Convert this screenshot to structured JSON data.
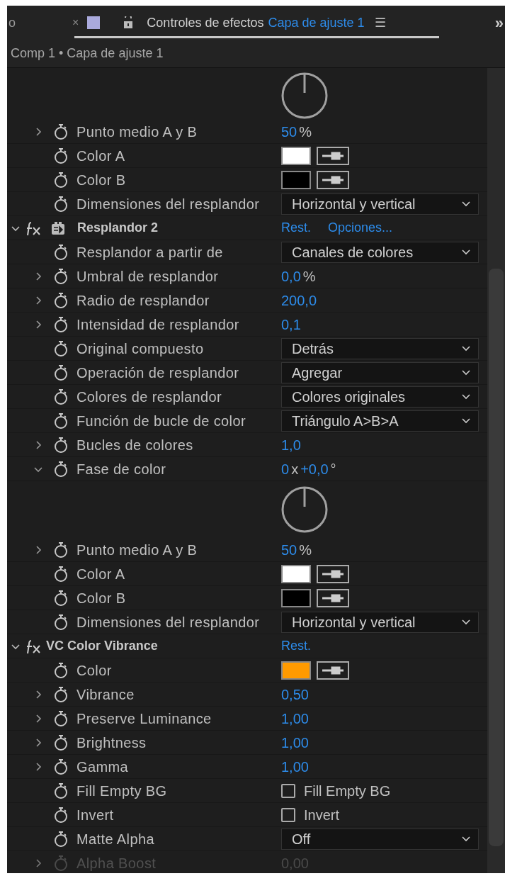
{
  "tab_bar": {
    "prev_tab": "o",
    "close": "×",
    "title": "Controles de efectos",
    "layer": "Capa de ajuste 1",
    "menu": "☰",
    "overflow": "»"
  },
  "breadcrumb": "Comp 1 • Capa de ajuste 1",
  "rows": [
    {
      "kind": "dial"
    },
    {
      "kind": "param",
      "label": "Punto medio A y B",
      "expandable": true,
      "expanded": false,
      "value": {
        "kind": "number",
        "segments": [
          {
            "kind": "number",
            "text": "50"
          },
          {
            "kind": "unit",
            "text": "%"
          }
        ]
      }
    },
    {
      "kind": "param",
      "label": "Color A",
      "expandable": false,
      "value": {
        "kind": "color",
        "color": "#ffffff"
      }
    },
    {
      "kind": "param",
      "label": "Color B",
      "expandable": false,
      "value": {
        "kind": "color",
        "color": "#000000"
      }
    },
    {
      "kind": "param",
      "label": "Dimensiones del resplandor",
      "expandable": false,
      "value": {
        "kind": "dropdown",
        "text": "Horizontal y vertical"
      }
    },
    {
      "kind": "effect",
      "name": "Resplandor 2",
      "expanded": true,
      "plugin_icon": true,
      "links": [
        "Rest.",
        "Opciones..."
      ]
    },
    {
      "kind": "param",
      "label": "Resplandor a partir de",
      "expandable": false,
      "value": {
        "kind": "dropdown",
        "text": "Canales de colores"
      }
    },
    {
      "kind": "param",
      "label": "Umbral de resplandor",
      "expandable": true,
      "expanded": false,
      "value": {
        "kind": "number",
        "segments": [
          {
            "kind": "number",
            "text": "0,0"
          },
          {
            "kind": "unit",
            "text": "%"
          }
        ]
      }
    },
    {
      "kind": "param",
      "label": "Radio de resplandor",
      "expandable": true,
      "expanded": false,
      "value": {
        "kind": "number",
        "segments": [
          {
            "kind": "number",
            "text": "200,0"
          }
        ]
      }
    },
    {
      "kind": "param",
      "label": "Intensidad de resplandor",
      "expandable": true,
      "expanded": false,
      "value": {
        "kind": "number",
        "segments": [
          {
            "kind": "number",
            "text": "0,1"
          }
        ]
      }
    },
    {
      "kind": "param",
      "label": "Original compuesto",
      "expandable": false,
      "value": {
        "kind": "dropdown",
        "text": "Detrás"
      }
    },
    {
      "kind": "param",
      "label": "Operación de resplandor",
      "expandable": false,
      "value": {
        "kind": "dropdown",
        "text": "Agregar"
      }
    },
    {
      "kind": "param",
      "label": "Colores de resplandor",
      "expandable": false,
      "value": {
        "kind": "dropdown",
        "text": "Colores originales"
      }
    },
    {
      "kind": "param",
      "label": "Función de bucle de color",
      "expandable": false,
      "value": {
        "kind": "dropdown",
        "text": "Triángulo A>B>A"
      }
    },
    {
      "kind": "param",
      "label": "Bucles de colores",
      "expandable": true,
      "expanded": false,
      "value": {
        "kind": "number",
        "segments": [
          {
            "kind": "number",
            "text": "1,0"
          }
        ]
      }
    },
    {
      "kind": "param",
      "label": "Fase de color",
      "expandable": true,
      "expanded": true,
      "value": {
        "kind": "number",
        "segments": [
          {
            "kind": "number",
            "text": "0"
          },
          {
            "kind": "unit",
            "text": "x"
          },
          {
            "kind": "number",
            "text": "+0,0"
          },
          {
            "kind": "unit",
            "text": "°"
          }
        ]
      }
    },
    {
      "kind": "dial"
    },
    {
      "kind": "param",
      "label": "Punto medio A y B",
      "expandable": true,
      "expanded": false,
      "value": {
        "kind": "number",
        "segments": [
          {
            "kind": "number",
            "text": "50"
          },
          {
            "kind": "unit",
            "text": "%"
          }
        ]
      }
    },
    {
      "kind": "param",
      "label": "Color A",
      "expandable": false,
      "value": {
        "kind": "color",
        "color": "#ffffff"
      }
    },
    {
      "kind": "param",
      "label": "Color B",
      "expandable": false,
      "value": {
        "kind": "color",
        "color": "#000000"
      }
    },
    {
      "kind": "param",
      "label": "Dimensiones del resplandor",
      "expandable": false,
      "value": {
        "kind": "dropdown",
        "text": "Horizontal y vertical"
      }
    },
    {
      "kind": "effect",
      "name": "VC Color Vibrance",
      "expanded": true,
      "plugin_icon": false,
      "links": [
        "Rest."
      ]
    },
    {
      "kind": "param",
      "label": "Color",
      "expandable": false,
      "value": {
        "kind": "color",
        "color": "#ff9a00"
      }
    },
    {
      "kind": "param",
      "label": "Vibrance",
      "expandable": true,
      "expanded": false,
      "value": {
        "kind": "number",
        "segments": [
          {
            "kind": "number",
            "text": "0,50"
          }
        ]
      }
    },
    {
      "kind": "param",
      "label": "Preserve Luminance",
      "expandable": true,
      "expanded": false,
      "value": {
        "kind": "number",
        "segments": [
          {
            "kind": "number",
            "text": "1,00"
          }
        ]
      }
    },
    {
      "kind": "param",
      "label": "Brightness",
      "expandable": true,
      "expanded": false,
      "value": {
        "kind": "number",
        "segments": [
          {
            "kind": "number",
            "text": "1,00"
          }
        ]
      }
    },
    {
      "kind": "param",
      "label": "Gamma",
      "expandable": true,
      "expanded": false,
      "value": {
        "kind": "number",
        "segments": [
          {
            "kind": "number",
            "text": "1,00"
          }
        ]
      }
    },
    {
      "kind": "param",
      "label": "Fill Empty BG",
      "expandable": false,
      "value": {
        "kind": "checkbox",
        "checked": false,
        "text": "Fill Empty BG"
      }
    },
    {
      "kind": "param",
      "label": "Invert",
      "expandable": false,
      "value": {
        "kind": "checkbox",
        "checked": false,
        "text": "Invert"
      }
    },
    {
      "kind": "param",
      "label": "Matte Alpha",
      "expandable": false,
      "value": {
        "kind": "dropdown",
        "text": "Off"
      }
    },
    {
      "kind": "param",
      "label": "Alpha Boost",
      "expandable": true,
      "expanded": false,
      "disabled": true,
      "value": {
        "kind": "number",
        "segments": [
          {
            "kind": "number",
            "text": "0,00"
          }
        ]
      }
    }
  ]
}
